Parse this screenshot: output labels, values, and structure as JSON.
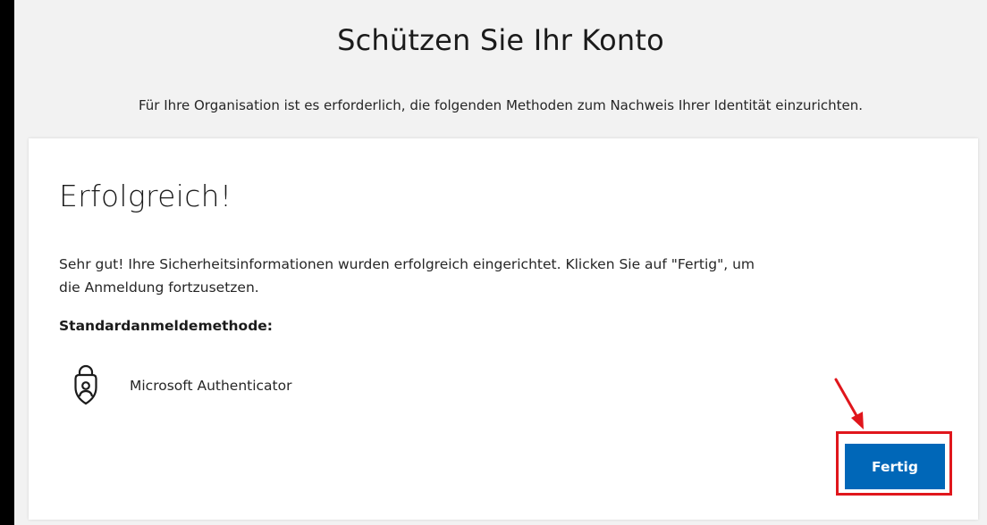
{
  "header": {
    "title": "Schützen Sie Ihr Konto",
    "subtitle": "Für Ihre Organisation ist es erforderlich, die folgenden Methoden zum Nachweis Ihrer Identität einzurichten."
  },
  "card": {
    "heading": "Erfolgreich!",
    "message": "Sehr gut! Ihre Sicherheitsinformationen wurden erfolgreich eingerichtet. Klicken Sie auf \"Fertig\", um die Anmeldung fortzusetzen.",
    "default_method_label": "Standardanmeldemethode:",
    "method": {
      "icon": "authenticator-lock-icon",
      "name": "Microsoft Authenticator"
    },
    "done_label": "Fertig"
  },
  "colors": {
    "page_background": "#f2f2f2",
    "card_background": "#ffffff",
    "button_primary": "#0067b8",
    "annotation_red": "#e0161c"
  }
}
